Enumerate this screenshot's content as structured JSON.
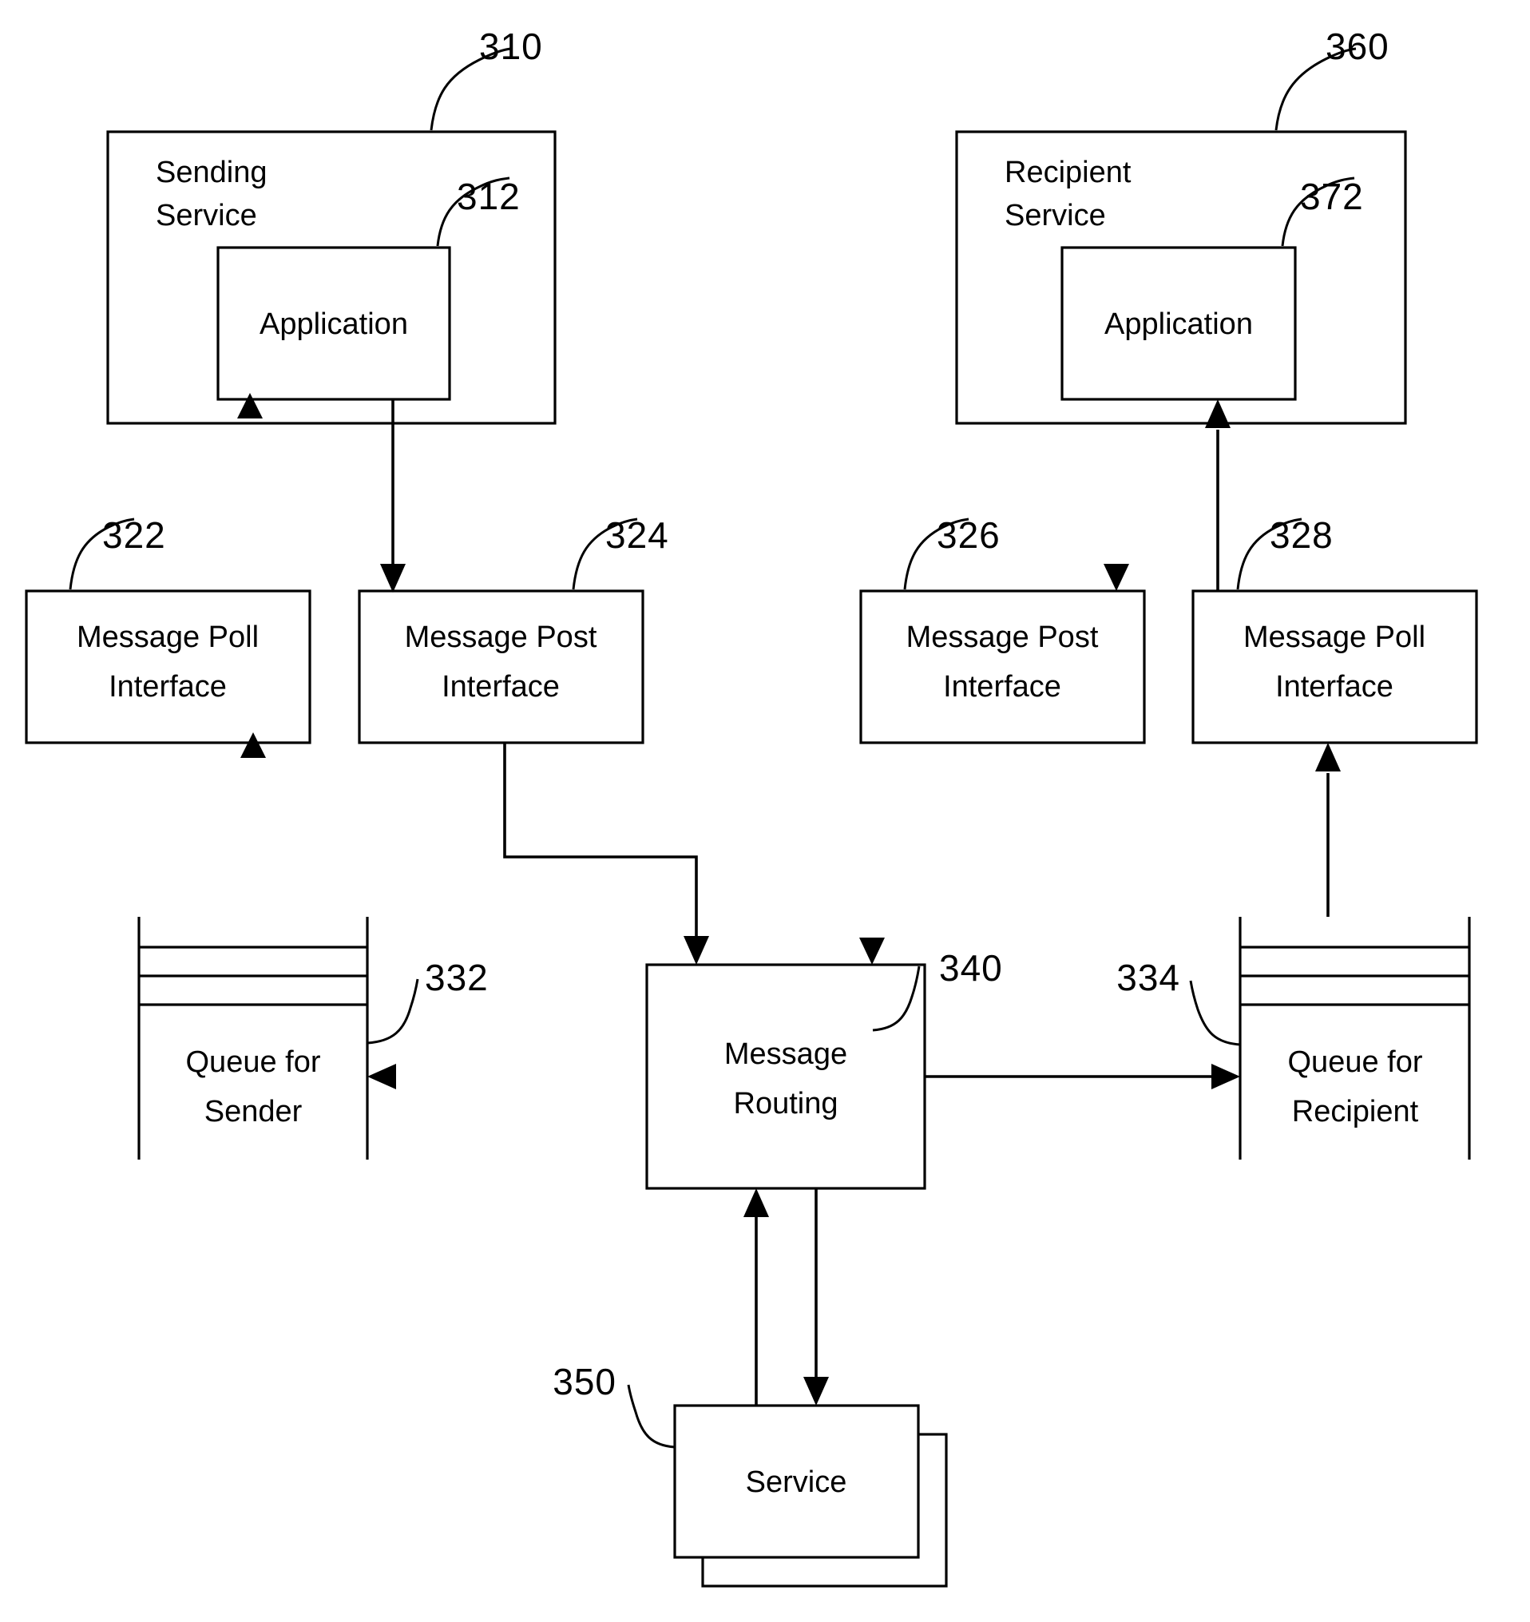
{
  "figure": {
    "type": "patent-block-diagram",
    "background_color": "#ffffff",
    "line_color": "#000000"
  },
  "nodes": {
    "sending_service": {
      "ref": "310",
      "label_line1": "Sending",
      "label_line2": "Service"
    },
    "sending_application": {
      "ref": "312",
      "label": "Application"
    },
    "recipient_service": {
      "ref": "360",
      "label_line1": "Recipient",
      "label_line2": "Service"
    },
    "recipient_application": {
      "ref": "372",
      "label": "Application"
    },
    "sender_message_poll_interface": {
      "ref": "322",
      "label_line1": "Message Poll",
      "label_line2": "Interface"
    },
    "sender_message_post_interface": {
      "ref": "324",
      "label_line1": "Message Post",
      "label_line2": "Interface"
    },
    "recipient_message_post_interface": {
      "ref": "326",
      "label_line1": "Message Post",
      "label_line2": "Interface"
    },
    "recipient_message_poll_interface": {
      "ref": "328",
      "label_line1": "Message Poll",
      "label_line2": "Interface"
    },
    "queue_for_sender": {
      "ref": "332",
      "label_line1": "Queue for",
      "label_line2": "Sender"
    },
    "queue_for_recipient": {
      "ref": "334",
      "label_line1": "Queue for",
      "label_line2": "Recipient"
    },
    "message_routing": {
      "ref": "340",
      "label_line1": "Message",
      "label_line2": "Routing"
    },
    "service": {
      "ref": "350",
      "label": "Service"
    }
  }
}
